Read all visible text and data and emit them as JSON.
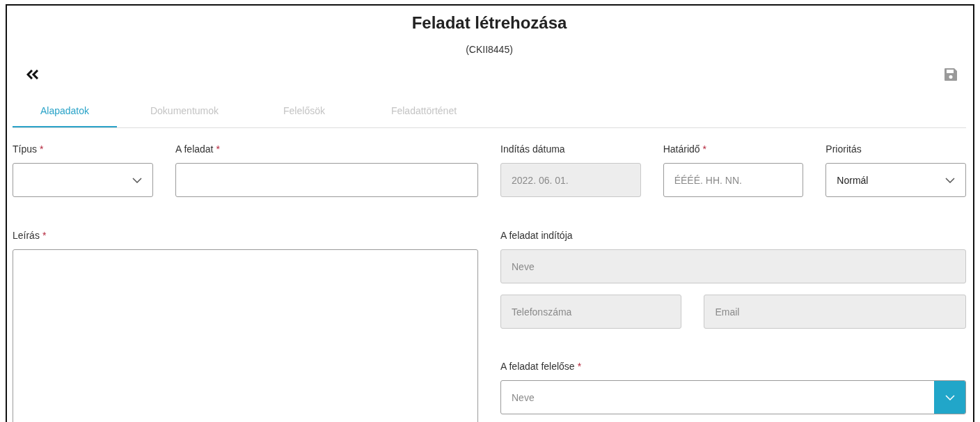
{
  "title": "Feladat létrehozása",
  "subtitle": "(CKII8445)",
  "required_mark": "*",
  "tabs": [
    {
      "label": "Alapadatok",
      "selected": true
    },
    {
      "label": "Dokumentumok",
      "selected": false
    },
    {
      "label": "Felelősök",
      "selected": false
    },
    {
      "label": "Feladattörténet",
      "selected": false
    }
  ],
  "left": {
    "row": [
      {
        "kind": "select",
        "label": "Típus",
        "required": true,
        "disabled": false
      },
      {
        "kind": "text",
        "label": "A feladat",
        "required": true,
        "disabled": false
      }
    ],
    "description": {
      "kind": "textarea",
      "label": "Leírás",
      "required": true,
      "disabled": false
    }
  },
  "right": {
    "row": [
      {
        "kind": "text",
        "label": "Indítás dátuma",
        "required": false,
        "disabled": true,
        "value": "2022. 06. 01."
      },
      {
        "kind": "text",
        "label": "Határidő",
        "required": true,
        "disabled": false,
        "placeholder": "ÉÉÉÉ. HH. NN."
      },
      {
        "kind": "select",
        "label": "Prioritás",
        "required": false,
        "disabled": false,
        "value": "Normál"
      }
    ],
    "initiator": {
      "label": "A feladat indítója",
      "name": {
        "kind": "text",
        "disabled": true,
        "placeholder": "Neve"
      },
      "contacts": [
        {
          "kind": "text",
          "disabled": true,
          "placeholder": "Telefonszáma"
        },
        {
          "kind": "text",
          "disabled": true,
          "placeholder": "Email"
        }
      ]
    },
    "owner": {
      "label": "A feladat felelőse",
      "required": true,
      "field": {
        "kind": "combo",
        "disabled": false,
        "placeholder": "Neve"
      }
    }
  }
}
